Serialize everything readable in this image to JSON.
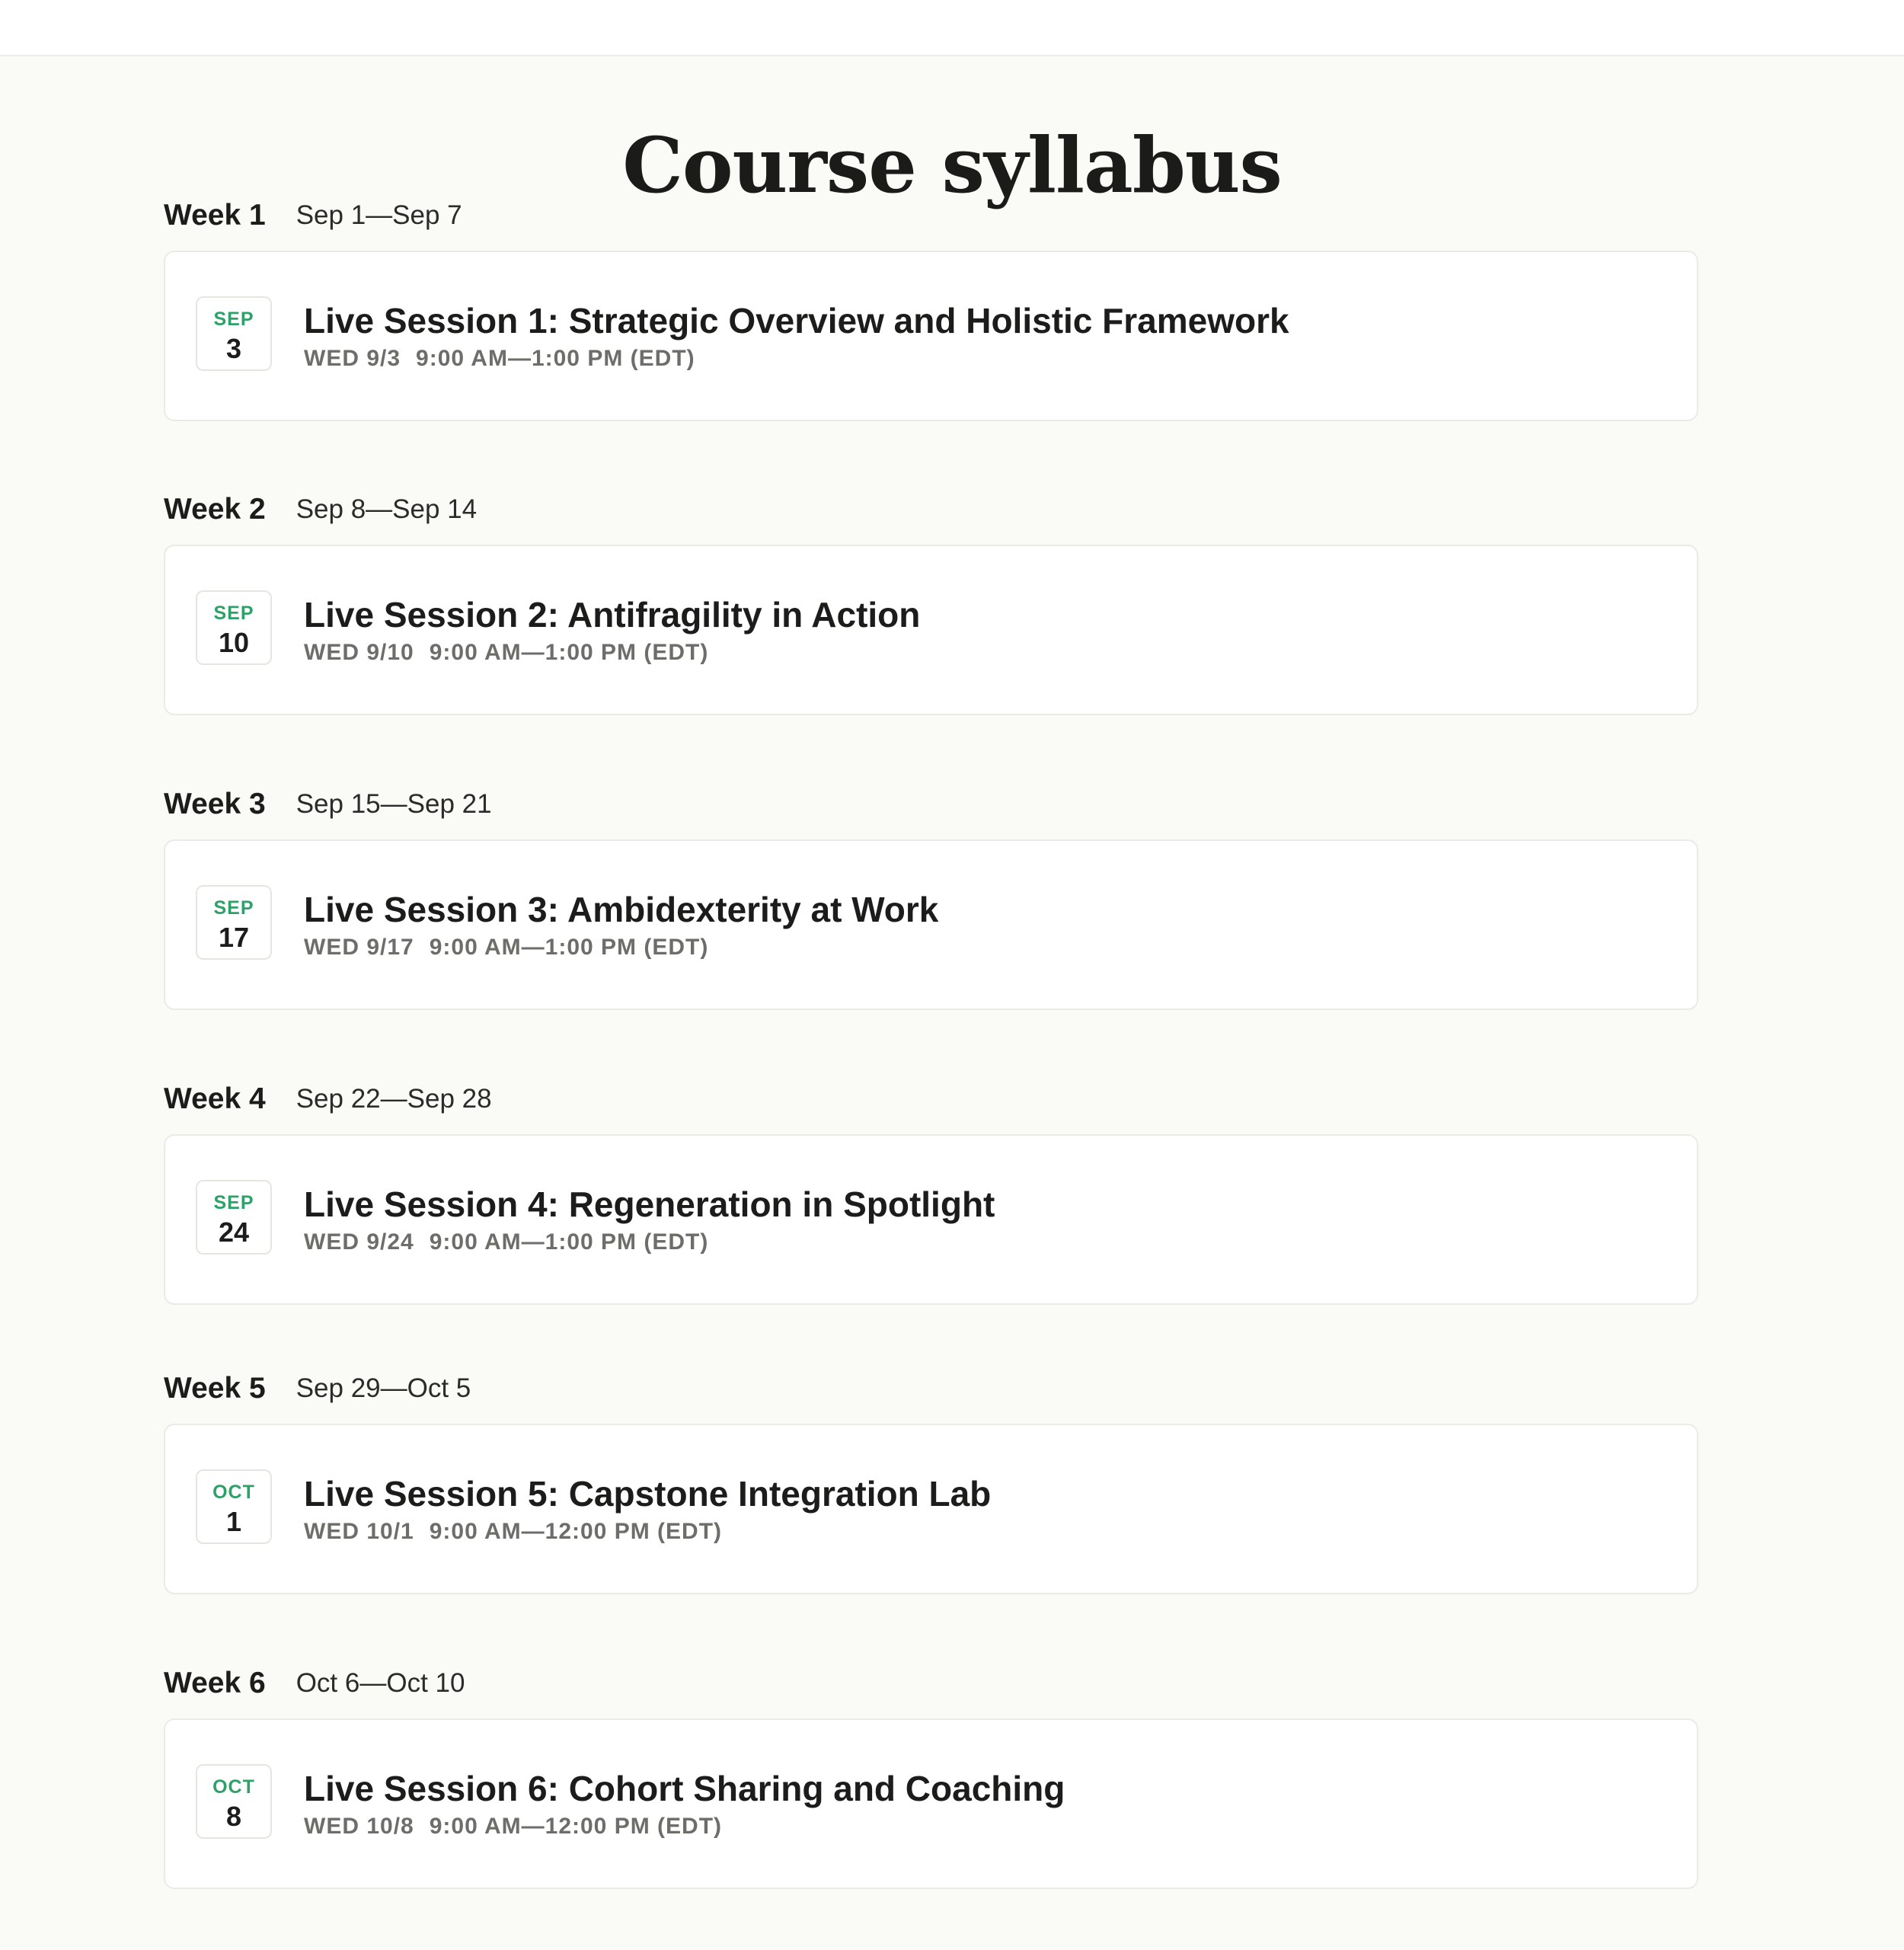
{
  "page": {
    "title": "Course syllabus"
  },
  "weeks": [
    {
      "label": "Week 1",
      "range": "Sep 1—Sep 7",
      "session": {
        "month": "SEP",
        "day": "3",
        "title": "Live Session 1: Strategic Overview and Holistic Framework",
        "weekday_date": "WED 9/3",
        "time": "9:00 AM—1:00 PM (EDT)"
      }
    },
    {
      "label": "Week 2",
      "range": "Sep 8—Sep 14",
      "session": {
        "month": "SEP",
        "day": "10",
        "title": "Live Session 2: Antifragility in Action",
        "weekday_date": "WED 9/10",
        "time": "9:00 AM—1:00 PM (EDT)"
      }
    },
    {
      "label": "Week 3",
      "range": "Sep 15—Sep 21",
      "session": {
        "month": "SEP",
        "day": "17",
        "title": "Live Session 3: Ambidexterity at Work",
        "weekday_date": "WED 9/17",
        "time": "9:00 AM—1:00 PM (EDT)"
      }
    },
    {
      "label": "Week 4",
      "range": "Sep 22—Sep 28",
      "session": {
        "month": "SEP",
        "day": "24",
        "title": "Live Session 4: Regeneration in Spotlight",
        "weekday_date": "WED 9/24",
        "time": "9:00 AM—1:00 PM (EDT)"
      }
    },
    {
      "label": "Week 5",
      "range": "Sep 29—Oct 5",
      "session": {
        "month": "OCT",
        "day": "1",
        "title": "Live Session 5: Capstone Integration Lab",
        "weekday_date": "WED 10/1",
        "time": "9:00 AM—12:00 PM (EDT)"
      }
    },
    {
      "label": "Week 6",
      "range": "Oct 6—Oct 10",
      "session": {
        "month": "OCT",
        "day": "8",
        "title": "Live Session 6: Cohort Sharing and Coaching",
        "weekday_date": "WED 10/8",
        "time": "9:00 AM—12:00 PM (EDT)"
      }
    }
  ],
  "colors": {
    "accent_month": "#2ea169",
    "background": "#fafaf7",
    "card": "#ffffff"
  }
}
